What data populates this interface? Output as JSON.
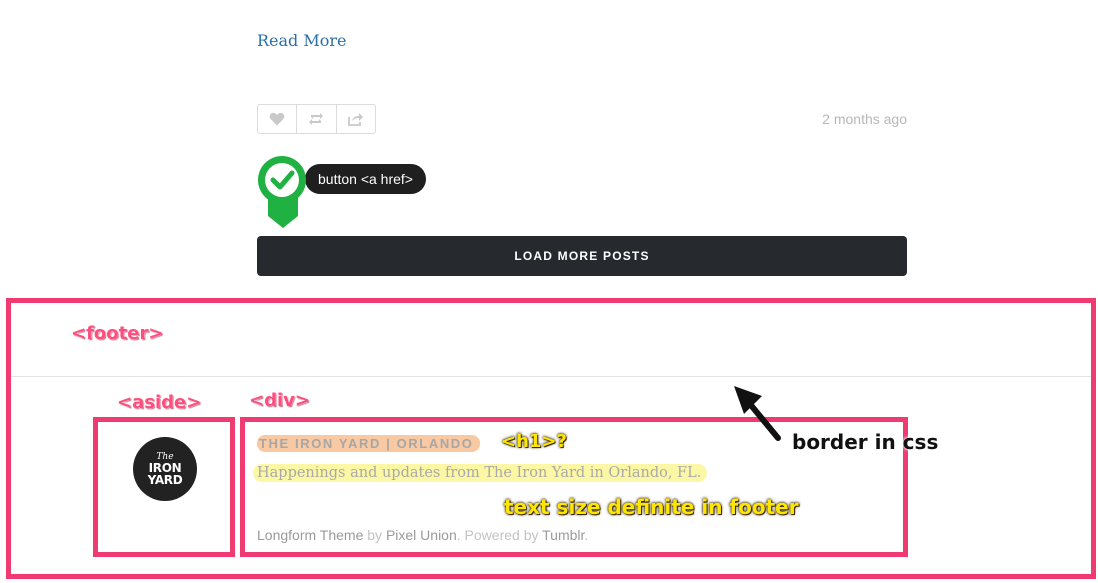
{
  "post": {
    "read_more": "Read More",
    "time_ago": "2 months ago"
  },
  "actions": [
    {
      "name": "like",
      "icon": "heart-icon"
    },
    {
      "name": "reblog",
      "icon": "reblog-icon"
    },
    {
      "name": "share",
      "icon": "share-icon"
    }
  ],
  "load_more": "LOAD MORE POSTS",
  "annotations": {
    "button": "button <a href>",
    "footer": "<footer>",
    "aside": "<aside>",
    "div": "<div>",
    "h1": "<h1>?",
    "text_size": "text size definite in footer",
    "border": "border in css"
  },
  "footer": {
    "logo": {
      "line1": "The",
      "line2": "IRON",
      "line3": "YARD"
    },
    "site_title": "THE IRON YARD | ORLANDO",
    "tagline": "Happenings and updates from The Iron Yard in Orlando, FL.",
    "credit": {
      "theme": "Longform Theme",
      "by": " by ",
      "author": "Pixel Union",
      "powered": ". Powered by ",
      "platform": "Tumblr",
      "end": "."
    }
  },
  "colors": {
    "annotation_pink": "#ef3a72",
    "link_blue": "#2b6fa8",
    "button_dark": "#26292d",
    "check_green": "#1fb141"
  }
}
